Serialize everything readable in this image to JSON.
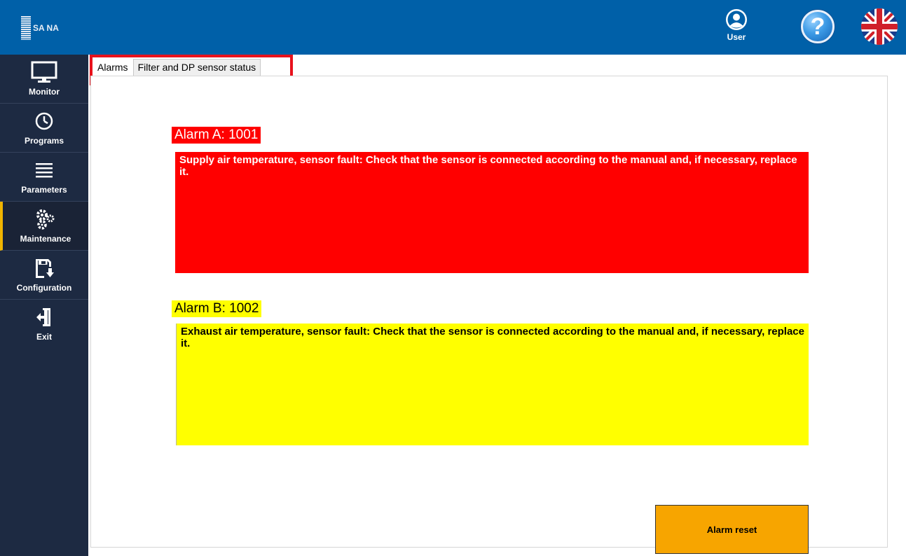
{
  "header": {
    "logo_text": "SA NA",
    "user_label": "User",
    "help_symbol": "?",
    "language": "uk-flag-icon"
  },
  "sidebar": {
    "items": [
      {
        "label": "Monitor",
        "icon": "monitor-icon"
      },
      {
        "label": "Programs",
        "icon": "clock-icon"
      },
      {
        "label": "Parameters",
        "icon": "list-icon"
      },
      {
        "label": "Maintenance",
        "icon": "gears-icon",
        "active": true
      },
      {
        "label": "Configuration",
        "icon": "save-download-icon"
      },
      {
        "label": "Exit",
        "icon": "exit-door-icon"
      }
    ]
  },
  "tabs": [
    {
      "label": "Alarms",
      "active": true
    },
    {
      "label": "Filter and DP sensor status",
      "active": false
    }
  ],
  "alarms": {
    "a": {
      "title": "Alarm A: 1001",
      "message": "Supply air temperature, sensor fault: Check that the sensor is connected according to the manual and, if necessary, replace it.",
      "color": "#ff0000"
    },
    "b": {
      "title": "Alarm B: 1002",
      "message": "Exhaust air temperature, sensor fault: Check that the sensor is connected according to the manual and, if necessary, replace it.",
      "color": "#ffff00"
    }
  },
  "reset_button": {
    "label": "Alarm reset",
    "color": "#f7a500"
  },
  "colors": {
    "header": "#0060a8",
    "sidebar": "#1d2a42",
    "active_marker": "#f0b400",
    "highlight": "#e8121c"
  }
}
